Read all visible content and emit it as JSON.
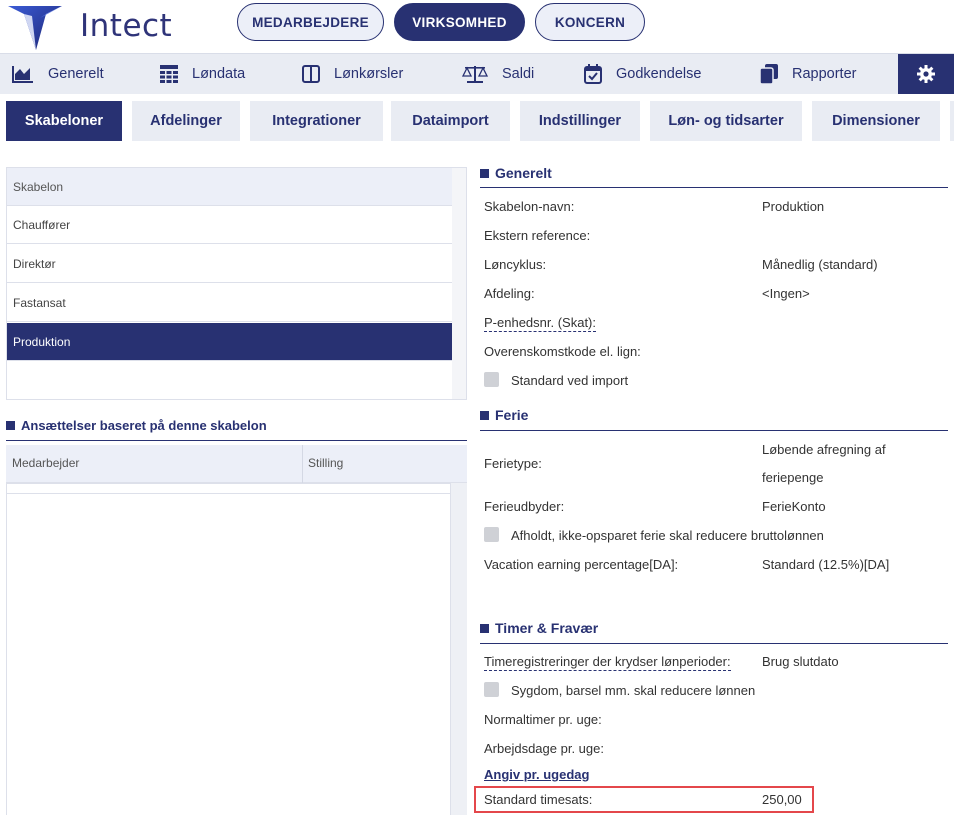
{
  "brand": {
    "name": "Intect"
  },
  "top_pills": [
    {
      "label": "MEDARBEJDERE",
      "active": false
    },
    {
      "label": "VIRKSOMHED",
      "active": true
    },
    {
      "label": "KONCERN",
      "active": false
    }
  ],
  "main_nav": [
    {
      "label": "Generelt",
      "icon": "chart-area-icon"
    },
    {
      "label": "Løndata",
      "icon": "table-grid-icon"
    },
    {
      "label": "Lønkørsler",
      "icon": "columns-icon"
    },
    {
      "label": "Saldi",
      "icon": "scale-icon"
    },
    {
      "label": "Godkendelse",
      "icon": "calendar-check-icon"
    },
    {
      "label": "Rapporter",
      "icon": "copy-icon"
    }
  ],
  "settings_icon": "gear-icon",
  "sub_tabs": [
    {
      "label": "Skabeloner",
      "active": true
    },
    {
      "label": "Afdelinger",
      "active": false
    },
    {
      "label": "Integrationer",
      "active": false
    },
    {
      "label": "Dataimport",
      "active": false
    },
    {
      "label": "Indstillinger",
      "active": false
    },
    {
      "label": "Løn- og tidsarter",
      "active": false
    },
    {
      "label": "Dimensioner",
      "active": false
    }
  ],
  "templates": {
    "header": "Skabelon",
    "items": [
      "Chauffører",
      "Direktør",
      "Fastansat",
      "Produktion"
    ],
    "selected": "Produktion"
  },
  "employments": {
    "title": "Ansættelser baseret på denne skabelon",
    "col_employee": "Medarbejder",
    "col_position": "Stilling"
  },
  "generelt": {
    "title": "Generelt",
    "template_name_label": "Skabelon-navn:",
    "template_name_value": "Produktion",
    "external_ref_label": "Ekstern reference:",
    "pay_cycle_label": "Løncyklus:",
    "pay_cycle_value": "Månedlig (standard)",
    "department_label": "Afdeling:",
    "department_value": "<Ingen>",
    "punit_label": "P-enhedsnr. (Skat):",
    "agreement_label": "Overenskomstkode el. lign:",
    "standard_import_label": "Standard ved import"
  },
  "ferie": {
    "title": "Ferie",
    "type_label": "Ferietype:",
    "type_value_1": "Løbende afregning af",
    "type_value_2": "feriepenge",
    "provider_label": "Ferieudbyder:",
    "provider_value": "FerieKonto",
    "reduce_label": "Afholdt, ikke-opsparet ferie skal reducere bruttolønnen",
    "earning_label": "Vacation earning percentage[DA]:",
    "earning_value": "Standard (12.5%)[DA]"
  },
  "timer": {
    "title": "Timer & Fravær",
    "crossing_label": "Timeregistreringer der krydser lønperioder:",
    "crossing_value": "Brug slutdato",
    "sick_label": "Sygdom, barsel mm. skal reducere lønnen",
    "normal_hours_label": "Normaltimer pr. uge:",
    "work_days_label": "Arbejdsdage pr. uge:",
    "per_weekday_link": "Angiv pr. ugedag",
    "hourly_rate_label": "Standard timesats:",
    "hourly_rate_value": "250,00"
  },
  "colors": {
    "navy": "#283172",
    "light": "#e9ecf3",
    "highlight": "#e4474b"
  }
}
